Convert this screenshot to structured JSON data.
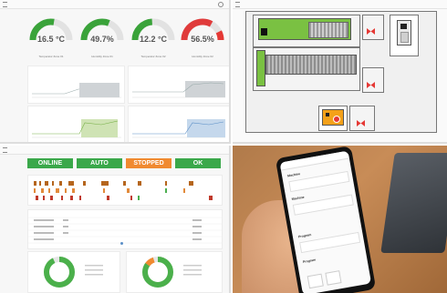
{
  "dashboard": {
    "gauges": [
      {
        "value": "16.5 °C",
        "caption": "Temperatur Zone 01",
        "fill": 0.55,
        "color": "#3aa33a"
      },
      {
        "value": "49.7%",
        "caption": "Humidity Zone 01",
        "fill": 0.62,
        "color": "#3aa33a"
      },
      {
        "value": "12.2 °C",
        "caption": "Temperatur Zone 02",
        "fill": 0.48,
        "color": "#3aa33a"
      },
      {
        "value": "56.5%",
        "caption": "Humidity Zone 02",
        "fill": 0.66,
        "color": "#e03b3b"
      }
    ]
  },
  "status": {
    "tiles": [
      {
        "label": "",
        "value": "ONLINE",
        "color": "#3aa84a"
      },
      {
        "label": "",
        "value": "AUTO",
        "color": "#3aa84a"
      },
      {
        "label": "",
        "value": "STOPPED",
        "color": "#f08a30"
      },
      {
        "label": "",
        "value": "OK",
        "color": "#3aa84a"
      }
    ],
    "donuts": [
      {
        "fill": 0.93,
        "color": "#4bb04b"
      },
      {
        "fill": 0.85,
        "color": "#4bb04b"
      }
    ]
  },
  "floorplan": {
    "colors": {
      "active": "#7ac142",
      "alert": "#e53935",
      "warn": "#f4a11a"
    }
  },
  "phone": {
    "items": [
      "Machine",
      "Machine",
      "Program",
      "Program"
    ]
  }
}
